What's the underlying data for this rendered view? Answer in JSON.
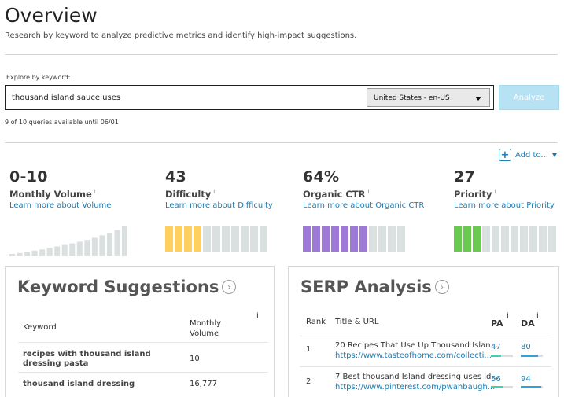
{
  "header": {
    "title": "Overview",
    "subtitle": "Research by keyword to analyze predictive metrics and identify high-impact suggestions."
  },
  "search": {
    "label": "Explore by keyword:",
    "value": "thousand island sauce uses",
    "locale": "United States - en-US",
    "analyze_label": "Analyze",
    "queries_text": "9 of 10 queries available until 06/01"
  },
  "add_to": {
    "label": "Add to..."
  },
  "metrics": [
    {
      "value": "0-10",
      "label": "Monthly Volume",
      "link": "Learn more about Volume",
      "info": "i"
    },
    {
      "value": "43",
      "label": "Difficulty",
      "link": "Learn more about Difficulty",
      "info": "i",
      "filled": 4,
      "total": 11,
      "color": "#ffcf5f"
    },
    {
      "value": "64%",
      "label": "Organic CTR",
      "link": "Learn more about Organic CTR",
      "info": "i",
      "filled": 7,
      "total": 11,
      "color": "#9e79d8"
    },
    {
      "value": "27",
      "label": "Priority",
      "link": "Learn more about Priority",
      "info": "i",
      "filled": 3,
      "total": 11,
      "color": "#6ac94f"
    }
  ],
  "volume_bars": [
    0.08,
    0.11,
    0.15,
    0.19,
    0.23,
    0.28,
    0.33,
    0.38,
    0.43,
    0.49,
    0.55,
    0.62,
    0.7,
    0.78,
    0.88,
    1.0
  ],
  "keyword_suggestions": {
    "title": "Keyword Suggestions",
    "col_keyword": "Keyword",
    "col_volume": "Monthly Volume",
    "info": "i",
    "rows": [
      {
        "keyword": "recipes with thousand island dressing pasta",
        "volume": "10"
      },
      {
        "keyword": "thousand island dressing",
        "volume": "16,777"
      }
    ]
  },
  "serp": {
    "title": "SERP Analysis",
    "col_rank": "Rank",
    "col_title": "Title & URL",
    "col_pa": "PA",
    "col_da": "DA",
    "info": "i",
    "rows": [
      {
        "rank": "1",
        "title": "20 Recipes That Use Up Thousand Islan...",
        "url": "https://www.tasteofhome.com/collecti...",
        "pa": "47",
        "da": "80",
        "pa_fill": 0.47,
        "da_fill": 0.8
      },
      {
        "rank": "2",
        "title": "7 Best thousand Island dressing uses id...",
        "url": "https://www.pinterest.com/pwanbaugh...",
        "pa": "56",
        "da": "94",
        "pa_fill": 0.56,
        "da_fill": 0.94
      }
    ]
  },
  "colors": {
    "link": "#1c7cb4",
    "pa": "#3fd1b5",
    "da": "#2fa3d9",
    "volume_bar": "#dadfe0"
  }
}
